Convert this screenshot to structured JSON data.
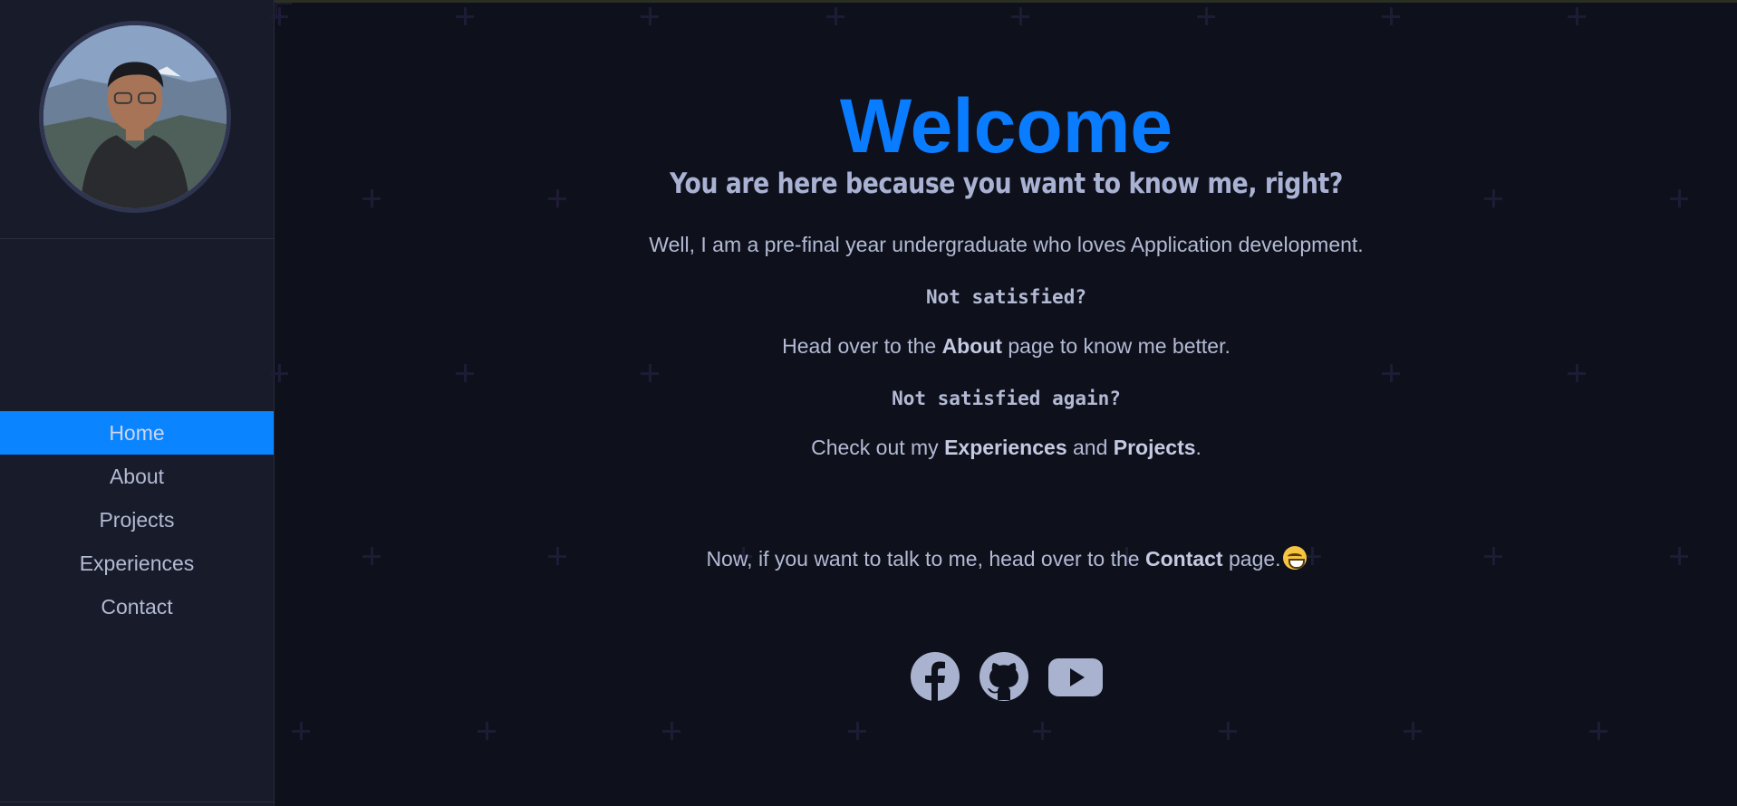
{
  "sidebar": {
    "avatar_alt": "profile photo",
    "nav": [
      {
        "label": "Home",
        "active": true
      },
      {
        "label": "About",
        "active": false
      },
      {
        "label": "Projects",
        "active": false
      },
      {
        "label": "Experiences",
        "active": false
      },
      {
        "label": "Contact",
        "active": false
      }
    ]
  },
  "main": {
    "title": "Welcome",
    "subtitle": "You are here because you want to know me, right?",
    "intro": "Well, I am a pre-final year undergraduate who loves Application development.",
    "not_satisfied": "Not satisfied?",
    "about_line": {
      "prefix": "Head over to the ",
      "bold": "About",
      "suffix": " page to know me better."
    },
    "not_satisfied_again": "Not satisfied again?",
    "projects_line": {
      "prefix": "Check out my ",
      "bold1": "Experiences",
      "mid": " and ",
      "bold2": "Projects",
      "suffix": "."
    },
    "contact_line": {
      "prefix": "Now, if you want to talk to me, head over to the ",
      "bold": "Contact",
      "suffix": " page."
    },
    "emoji": "grinning-face-emoji"
  },
  "social": [
    {
      "name": "facebook-icon"
    },
    {
      "name": "github-icon"
    },
    {
      "name": "youtube-icon"
    }
  ],
  "colors": {
    "accent": "#0a84ff",
    "background": "#0e111c",
    "sidebar": "#181b29",
    "text": "#b3bad4"
  }
}
